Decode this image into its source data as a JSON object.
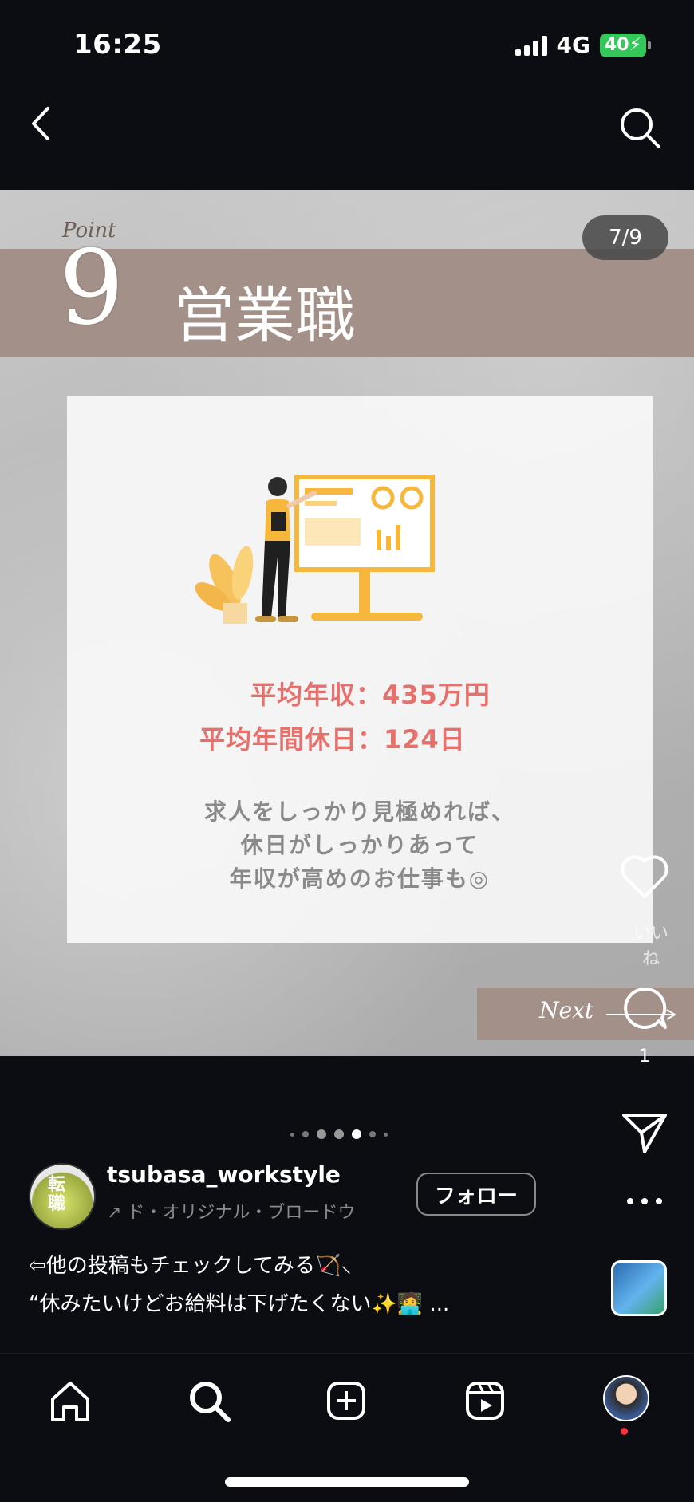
{
  "status_bar": {
    "time": "16:25",
    "network": "4G",
    "battery": "40"
  },
  "slide": {
    "point_label": "Point",
    "point_number": "9",
    "title": "営業職",
    "page_indicator": "7/9",
    "salary_line": "平均年収：435万円",
    "holiday_line": "平均年間休日：124日",
    "description": [
      "求人をしっかり見極めれば、",
      "休日がしっかりあって",
      "年収が高めのお仕事も◎"
    ],
    "next_label": "Next"
  },
  "actions": {
    "like_label": "いいね",
    "comment_count": "1"
  },
  "post": {
    "username": "tsubasa_workstyle",
    "avatar_text": "転職",
    "audio_text": "↗ ド・オリジナル・ブロードウ",
    "follow_label": "フォロー",
    "caption_line1": "⇦他の投稿もチェックしてみる🏹⸜",
    "caption_line2": "“休みたいけどお給料は下げたくない✨🧑‍💻 ..."
  },
  "colors": {
    "band": "#a39189",
    "highlight_text": "#e5706c",
    "battery": "#34c759"
  },
  "icons": [
    "back-icon",
    "search-icon",
    "heart-icon",
    "comment-icon",
    "send-icon",
    "more-icon",
    "home-icon",
    "search-tab-icon",
    "create-icon",
    "reels-icon"
  ]
}
